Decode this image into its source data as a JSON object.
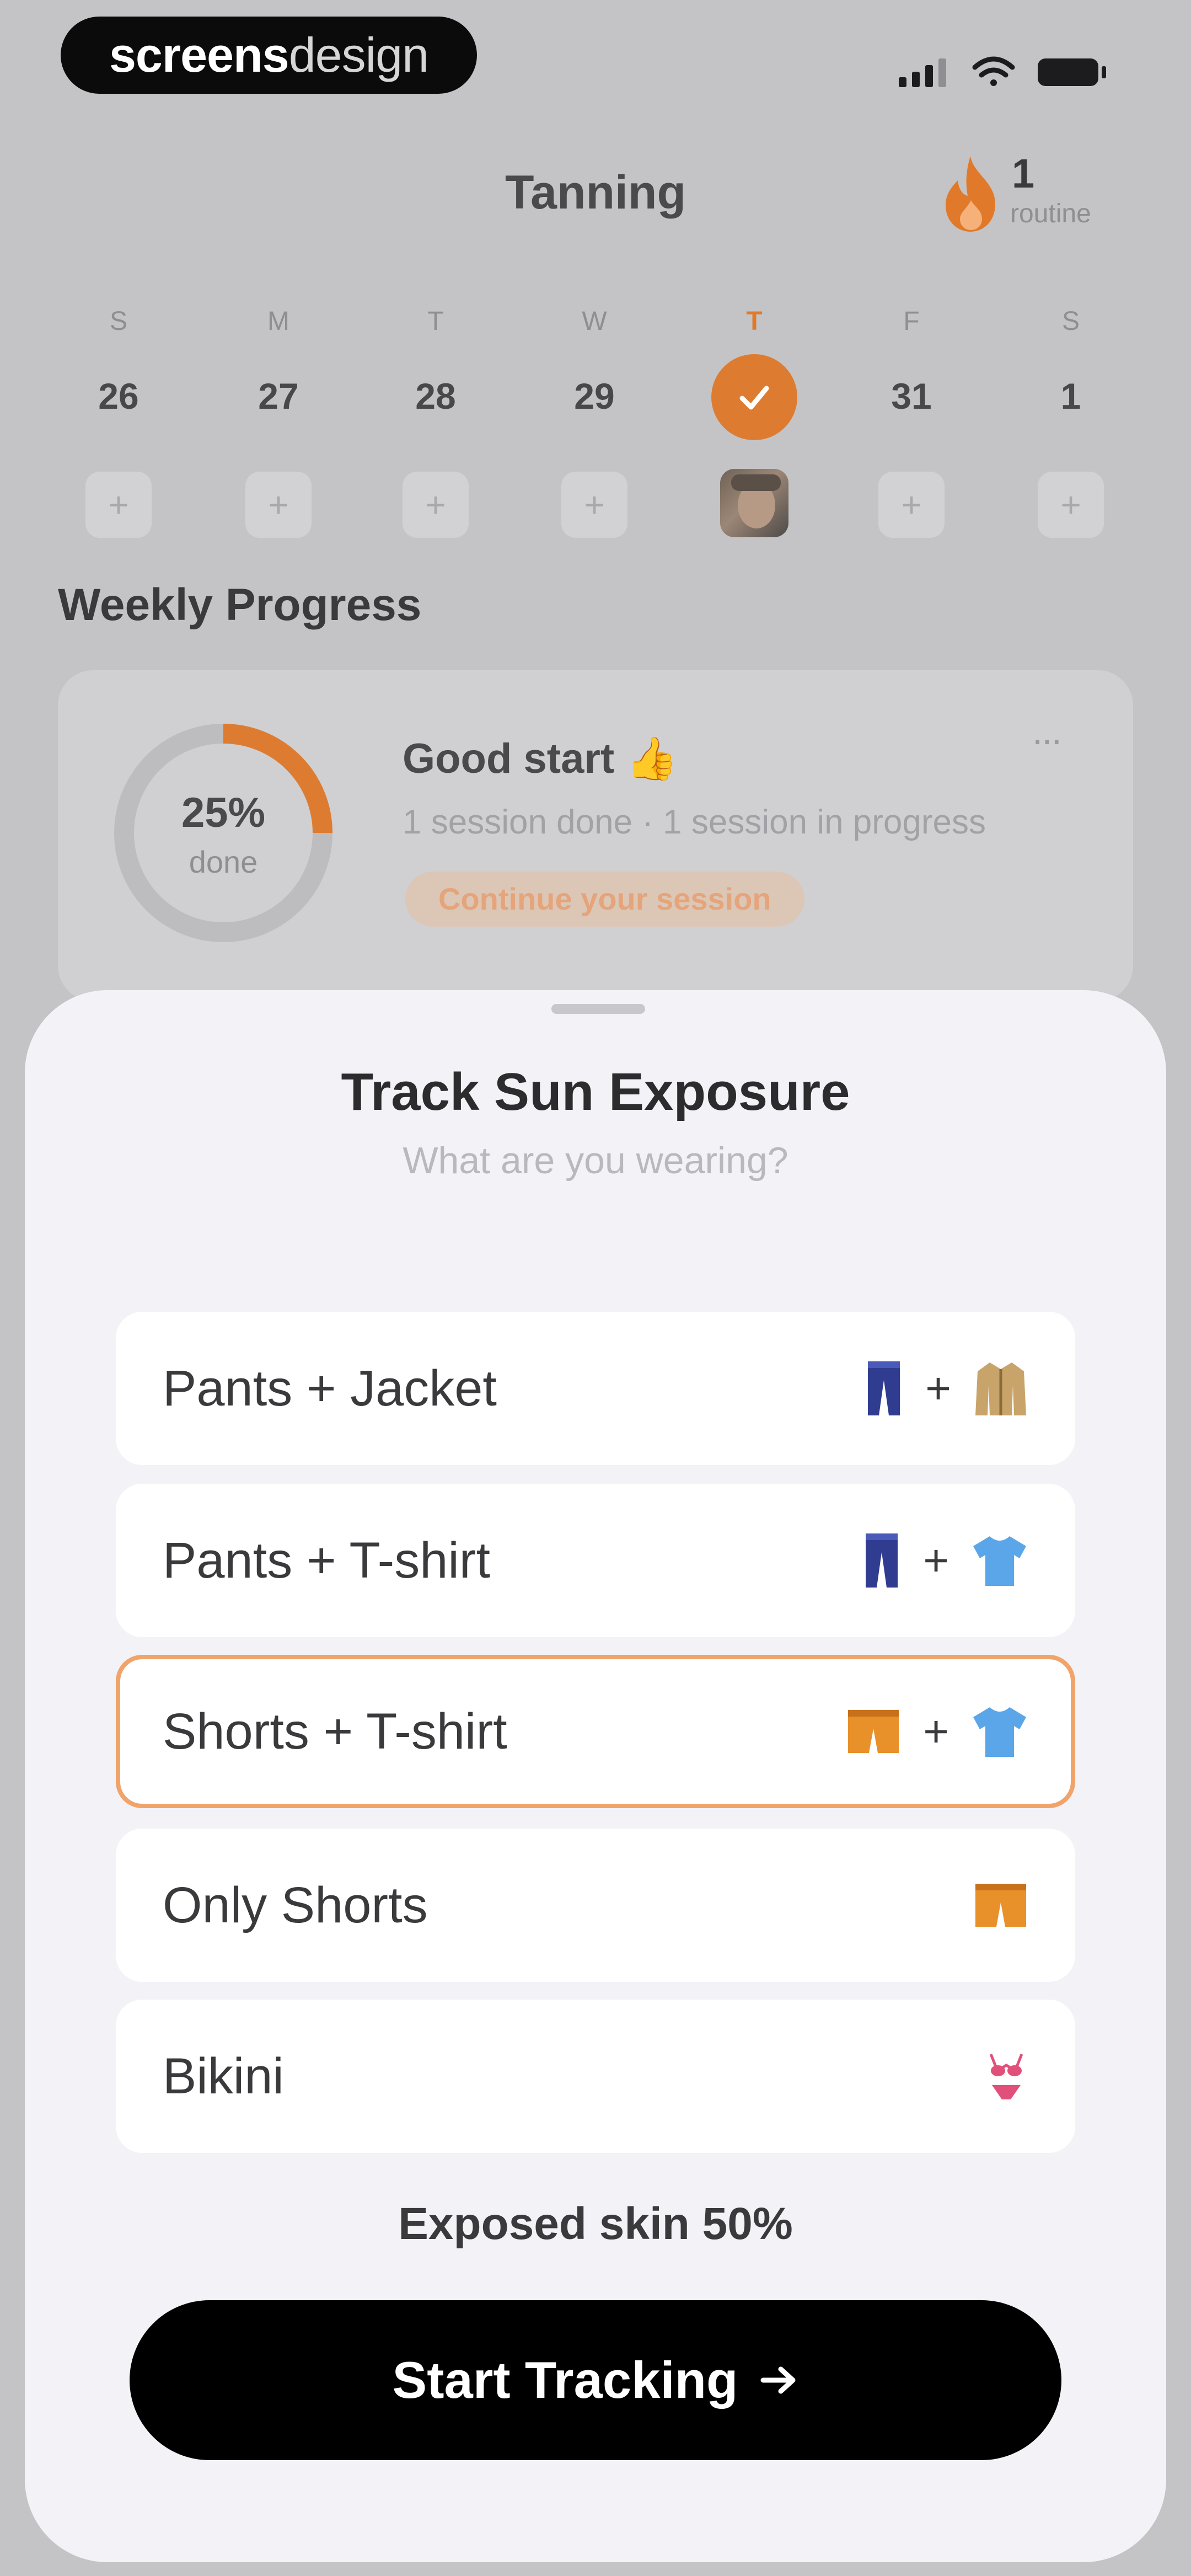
{
  "status_bar": {
    "brand_bold": "screens",
    "brand_light": "design"
  },
  "header": {
    "title": "Tanning",
    "streak_count": "1",
    "streak_label": "routine"
  },
  "calendar": {
    "days": [
      {
        "dow": "S",
        "date": "26"
      },
      {
        "dow": "M",
        "date": "27"
      },
      {
        "dow": "T",
        "date": "28"
      },
      {
        "dow": "W",
        "date": "29"
      },
      {
        "dow": "T",
        "date": ""
      },
      {
        "dow": "F",
        "date": "31"
      },
      {
        "dow": "S",
        "date": "1"
      }
    ],
    "add_symbol": "+"
  },
  "weekly_progress": {
    "heading": "Weekly Progress",
    "percent_text": "25%",
    "percent_value": 0.25,
    "done_label": "done",
    "status_title": "Good start 👍",
    "status_detail": "1 session done · 1 session in progress",
    "action_label": "Continue your session",
    "more_symbol": "···"
  },
  "sheet": {
    "title": "Track Sun Exposure",
    "subtitle": "What are you wearing?",
    "options": [
      {
        "label": "Pants + Jacket",
        "icons": [
          "pants-icon",
          "jacket-icon"
        ],
        "selected": false
      },
      {
        "label": "Pants + T-shirt",
        "icons": [
          "pants-icon",
          "tshirt-icon"
        ],
        "selected": false
      },
      {
        "label": "Shorts + T-shirt",
        "icons": [
          "shorts-icon",
          "tshirt-icon"
        ],
        "selected": true
      },
      {
        "label": "Only Shorts",
        "icons": [
          "shorts-icon"
        ],
        "selected": false
      },
      {
        "label": "Bikini",
        "icons": [
          "bikini-icon"
        ],
        "selected": false
      }
    ],
    "plus_symbol": "+",
    "exposed_skin": "Exposed skin 50%",
    "cta_label": "Start Tracking"
  },
  "colors": {
    "accent": "#dd7c31",
    "selected_border": "#f0a36a",
    "cta_background": "#000000",
    "pants_blue": "#2f3c8f",
    "tshirt_blue": "#5aa6e8",
    "shorts_orange": "#e8902a",
    "jacket_tan": "#c9a46a",
    "bikini_pink": "#e0507a"
  }
}
